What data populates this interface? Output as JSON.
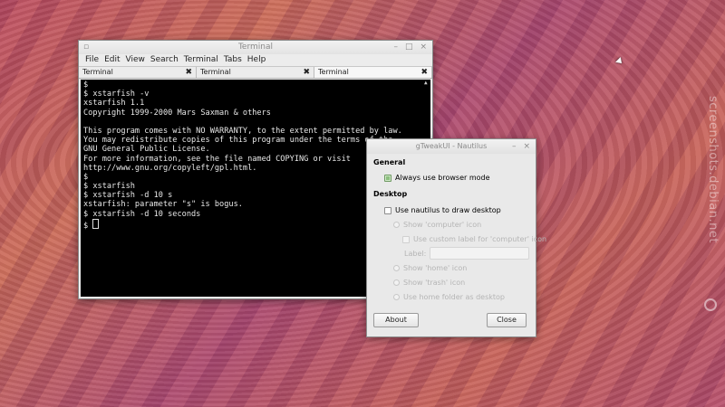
{
  "desktop": {
    "watermark": "screenshots.debian.net"
  },
  "terminal": {
    "title": "Terminal",
    "controls": {
      "minimize": "–",
      "maximize": "□",
      "close": "×"
    },
    "menu": [
      "File",
      "Edit",
      "View",
      "Search",
      "Terminal",
      "Tabs",
      "Help"
    ],
    "tabs": [
      {
        "label": "Terminal",
        "close": "✖"
      },
      {
        "label": "Terminal",
        "close": "✖"
      },
      {
        "label": "Terminal",
        "close": "✖"
      }
    ],
    "lines": [
      "$",
      "$ xstarfish -v",
      "xstarfish 1.1",
      "Copyright 1999-2000 Mars Saxman & others",
      "",
      "This program comes with NO WARRANTY, to the extent permitted by law.",
      "You may redistribute copies of this program under the terms of the",
      "GNU General Public License.",
      "For more information, see the file named COPYING or visit",
      "http://www.gnu.org/copyleft/gpl.html.",
      "$",
      "$ xstarfish",
      "$ xstarfish -d 10 s",
      "xstarfish: parameter \"s\" is bogus.",
      "$ xstarfish -d 10 seconds",
      "$ "
    ]
  },
  "gtweak": {
    "title": "gTweakUI - Nautilus",
    "controls": {
      "minimize": "–",
      "close": "×"
    },
    "general_heading": "General",
    "browser_mode": "Always use browser mode",
    "desktop_heading": "Desktop",
    "draw_desktop": "Use nautilus to draw desktop",
    "show_computer": "Show 'computer' icon",
    "custom_label": "Use custom label for 'computer' icon",
    "label_caption": "Label:",
    "show_home": "Show 'home' icon",
    "show_trash": "Show 'trash' icon",
    "home_as_desktop": "Use home folder as desktop",
    "about_label": "About",
    "close_label": "Close"
  }
}
